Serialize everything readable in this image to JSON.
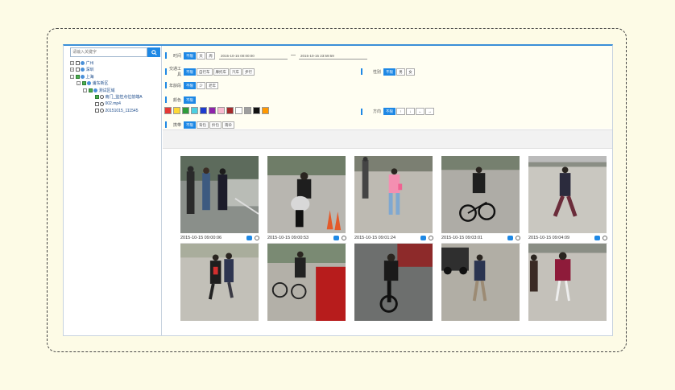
{
  "search": {
    "placeholder": "请输入关键字"
  },
  "tree": [
    {
      "label": "广州",
      "depth": 0,
      "expander": "+",
      "checked": false,
      "icon": "folder"
    },
    {
      "label": "深圳",
      "depth": 0,
      "expander": "+",
      "checked": false,
      "icon": "folder"
    },
    {
      "label": "上海",
      "depth": 0,
      "expander": "-",
      "checked": true,
      "icon": "folder"
    },
    {
      "label": "浦东新区",
      "depth": 1,
      "expander": "-",
      "checked": true,
      "icon": "folder"
    },
    {
      "label": "测试区域",
      "depth": 2,
      "expander": "-",
      "checked": true,
      "icon": "folder"
    },
    {
      "label": "南门_监控点位前端A",
      "depth": 3,
      "expander": "",
      "checked": true,
      "icon": "camera"
    },
    {
      "label": "002.mp4",
      "depth": 3,
      "expander": "",
      "checked": false,
      "icon": "camera"
    },
    {
      "label": "20151015_111545",
      "depth": 3,
      "expander": "",
      "checked": false,
      "icon": "camera"
    }
  ],
  "filters": {
    "time": {
      "label": "时间",
      "options": [
        "不限",
        "天",
        "周"
      ],
      "selected": 0,
      "start": "2015-10-15 00:00:00",
      "sep": "—",
      "end": "2015-10-15 23:59:59"
    },
    "vehicle": {
      "label": "交通工具",
      "options": [
        "不限",
        "自行车",
        "摩托车",
        "汽车",
        "步行"
      ],
      "selected": 0
    },
    "gender": {
      "label": "性别",
      "options": [
        "不限",
        "男",
        "女"
      ],
      "selected": 0
    },
    "age": {
      "label": "年龄段",
      "options": [
        "不限",
        "少",
        "老年"
      ],
      "selected": 0
    },
    "color": {
      "label": "颜色",
      "options": [
        "不限"
      ],
      "selected": 0,
      "swatches": [
        "#e53935",
        "#fdd835",
        "#2e9c3a",
        "#4dd0e1",
        "#1e3ccf",
        "#8e24aa",
        "#f8bbd0",
        "#a52a2a",
        "#ffffff",
        "#9e9e9e",
        "#111111",
        "#ff9800"
      ]
    },
    "direction": {
      "label": "方向",
      "options": [
        "不限",
        "↑",
        "↓",
        "←",
        "→"
      ],
      "selected": 0
    },
    "carry": {
      "label": "携带",
      "options": [
        "不限",
        "背包",
        "拎包",
        "雨伞"
      ],
      "selected": 0
    }
  },
  "results": [
    {
      "time": "2015-10-15 09:00:06",
      "scene": "group"
    },
    {
      "time": "2015-10-15 09:00:53",
      "scene": "moto"
    },
    {
      "time": "2015-10-15 09:01:24",
      "scene": "walk-pink"
    },
    {
      "time": "2015-10-15 09:03:01",
      "scene": "bike"
    },
    {
      "time": "2015-10-15 09:04:09",
      "scene": "walk-dark"
    },
    {
      "time": "",
      "scene": "pair"
    },
    {
      "time": "",
      "scene": "bike-rack"
    },
    {
      "time": "",
      "scene": "bike-front"
    },
    {
      "time": "",
      "scene": "walk-car"
    },
    {
      "time": "",
      "scene": "pair-red"
    }
  ],
  "colors": {
    "accent": "#1e88e5",
    "filter_bg": "#fffef2",
    "page_bg": "#fdfbe6"
  }
}
